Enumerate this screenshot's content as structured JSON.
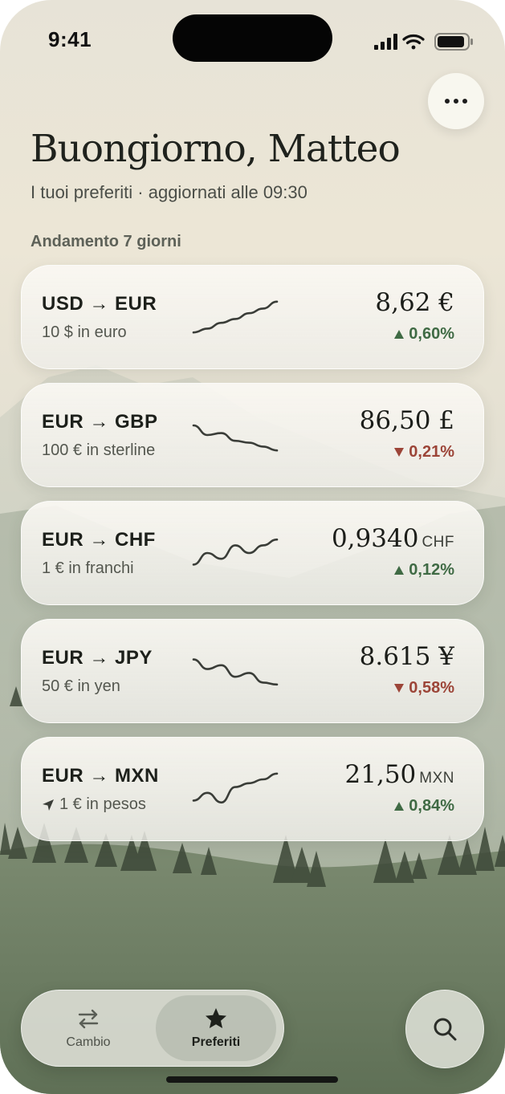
{
  "status_bar": {
    "time": "9:41"
  },
  "header": {
    "greeting": "Buongiorno, Matteo",
    "subtitle": "I tuoi preferiti · aggiornati alle 09:30",
    "more_icon": "ellipsis-icon"
  },
  "section_label": "Andamento 7 giorni",
  "colors": {
    "up": "#3f6a44",
    "down": "#9c4538",
    "sparkline": "#3a3d38"
  },
  "favorites": [
    {
      "pair": "USD → EUR",
      "description": "10 $ in euro",
      "value": "8,62 €",
      "unit": "",
      "change": "0,60%",
      "direction": "up",
      "location_icon": false,
      "trend": [
        0.1,
        0.2,
        0.35,
        0.45,
        0.6,
        0.72,
        0.9
      ]
    },
    {
      "pair": "EUR → GBP",
      "description": "100 € in sterline",
      "value": "86,50 £",
      "unit": "",
      "change": "0,21%",
      "direction": "down",
      "location_icon": false,
      "trend": [
        0.75,
        0.5,
        0.55,
        0.35,
        0.3,
        0.2,
        0.1
      ]
    },
    {
      "pair": "EUR → CHF",
      "description": "1 € in franchi",
      "value": "0,9340",
      "unit": "CHF",
      "change": "0,12%",
      "direction": "up",
      "location_icon": false,
      "trend": [
        0.2,
        0.5,
        0.35,
        0.7,
        0.5,
        0.7,
        0.85
      ]
    },
    {
      "pair": "EUR → JPY",
      "description": "50 € in yen",
      "value": "8.615 ¥",
      "unit": "",
      "change": "0,58%",
      "direction": "down",
      "location_icon": false,
      "trend": [
        0.8,
        0.55,
        0.65,
        0.35,
        0.45,
        0.2,
        0.15
      ]
    },
    {
      "pair": "EUR → MXN",
      "description": "1 € in pesos",
      "value": "21,50",
      "unit": "MXN",
      "change": "0,84%",
      "direction": "up",
      "location_icon": true,
      "trend": [
        0.2,
        0.4,
        0.15,
        0.55,
        0.65,
        0.75,
        0.9
      ]
    }
  ],
  "tabbar": {
    "tabs": [
      {
        "label": "Cambio",
        "icon": "swap-arrows-icon",
        "selected": false
      },
      {
        "label": "Preferiti",
        "icon": "star-icon",
        "selected": true
      }
    ]
  },
  "search_icon": "search-icon"
}
